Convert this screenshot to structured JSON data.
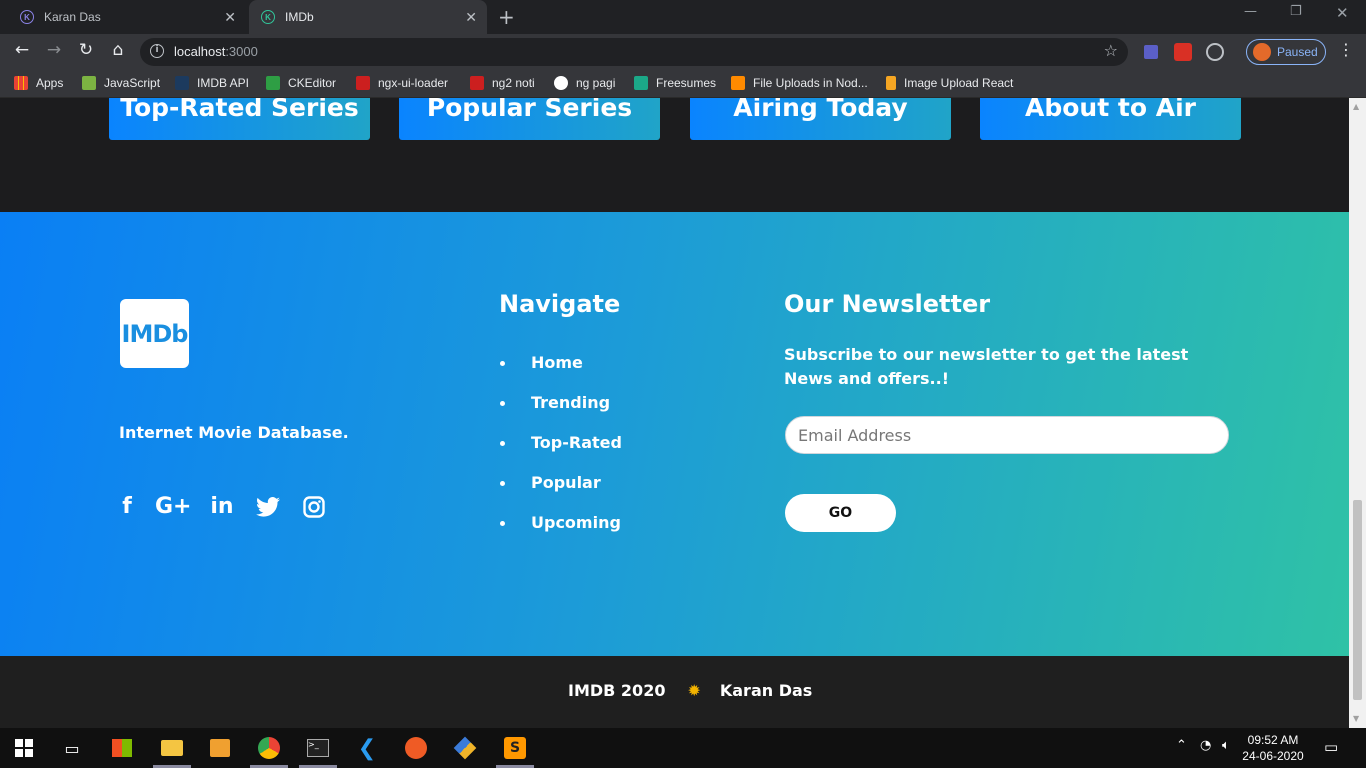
{
  "browser": {
    "tabs": [
      {
        "label": "Karan Das",
        "favicon": "K"
      },
      {
        "label": "IMDb",
        "favicon": "K"
      }
    ],
    "url_host": "localhost",
    "url_port": ":3000",
    "profile_status": "Paused",
    "bookmarks": [
      {
        "label": "Apps",
        "color": "#e94235"
      },
      {
        "label": "JavaScript",
        "color": "#7cb342"
      },
      {
        "label": "IMDB API",
        "color": "#1c3a5e"
      },
      {
        "label": "CKEditor",
        "color": "#2e9e44"
      },
      {
        "label": "ngx-ui-loader",
        "color": "#cc1f1f"
      },
      {
        "label": "ng2 noti",
        "color": "#cc1f1f"
      },
      {
        "label": "ng pagi",
        "color": "#ffffff"
      },
      {
        "label": "Freesumes",
        "color": "#1ba888"
      },
      {
        "label": "File Uploads in Nod...",
        "color": "#ff8a00"
      },
      {
        "label": "Image Upload React",
        "color": "#f5a623"
      }
    ]
  },
  "page": {
    "category_buttons": [
      "Top-Rated Series",
      "Popular Series",
      "Airing Today",
      "About to Air"
    ],
    "footer": {
      "logo_text": "IMDb",
      "tagline": "Internet Movie Database.",
      "social_icons": [
        "f",
        "G+",
        "in",
        "❚",
        "◎"
      ],
      "navigate_title": "Navigate",
      "nav_links": [
        "Home",
        "Trending",
        "Top-Rated",
        "Popular",
        "Upcoming"
      ],
      "newsletter_title": "Our Newsletter",
      "newsletter_text": "Subscribe to our newsletter to get the latest News and offers..!",
      "email_placeholder": "Email Address",
      "go_label": "GO"
    },
    "bottom_bar": {
      "left": "IMDB 2020",
      "right": "Karan Das"
    }
  },
  "taskbar": {
    "time": "09:52 AM",
    "date": "24-06-2020"
  },
  "colors": {
    "gradient_start": "#0a7ff5",
    "gradient_end": "#2fc2a6",
    "button_gradient": "#0a84ff"
  }
}
